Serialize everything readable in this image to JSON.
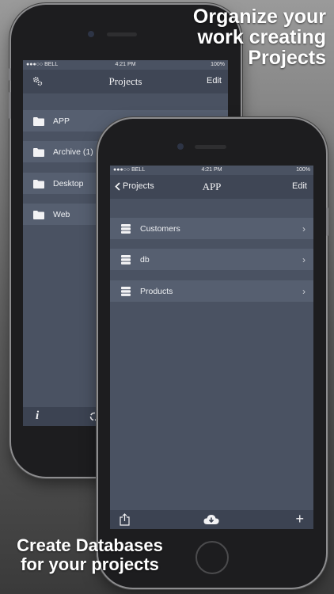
{
  "marketing": {
    "headline_top": "Organize your work creating Projects",
    "headline_bottom": "Create Databases for your projects"
  },
  "status_bar": {
    "carrier": "●●●○○ BELL",
    "time": "4:21 PM",
    "battery": "100%"
  },
  "projects_screen": {
    "title": "Projects",
    "edit_label": "Edit",
    "settings_icon": "gear-icon",
    "items": [
      {
        "label": "APP",
        "icon": "folder-icon"
      },
      {
        "label": "Archive (1)",
        "icon": "folder-icon"
      },
      {
        "label": "Desktop",
        "icon": "folder-icon"
      },
      {
        "label": "Web",
        "icon": "folder-icon"
      }
    ],
    "toolbar": {
      "info_icon": "info-icon",
      "sync_icon": "sync-icon"
    }
  },
  "app_screen": {
    "back_label": "Projects",
    "title": "APP",
    "edit_label": "Edit",
    "items": [
      {
        "label": "Customers",
        "icon": "database-icon"
      },
      {
        "label": "db",
        "icon": "database-icon"
      },
      {
        "label": "Products",
        "icon": "database-icon"
      }
    ],
    "toolbar": {
      "share_icon": "share-icon",
      "download_icon": "cloud-download-icon",
      "add_icon": "plus-icon"
    }
  },
  "colors": {
    "screen_bg": "#4a5262",
    "navbar_bg": "#3f4655",
    "row_bg": "#565f70",
    "text": "#f2f2f4"
  }
}
